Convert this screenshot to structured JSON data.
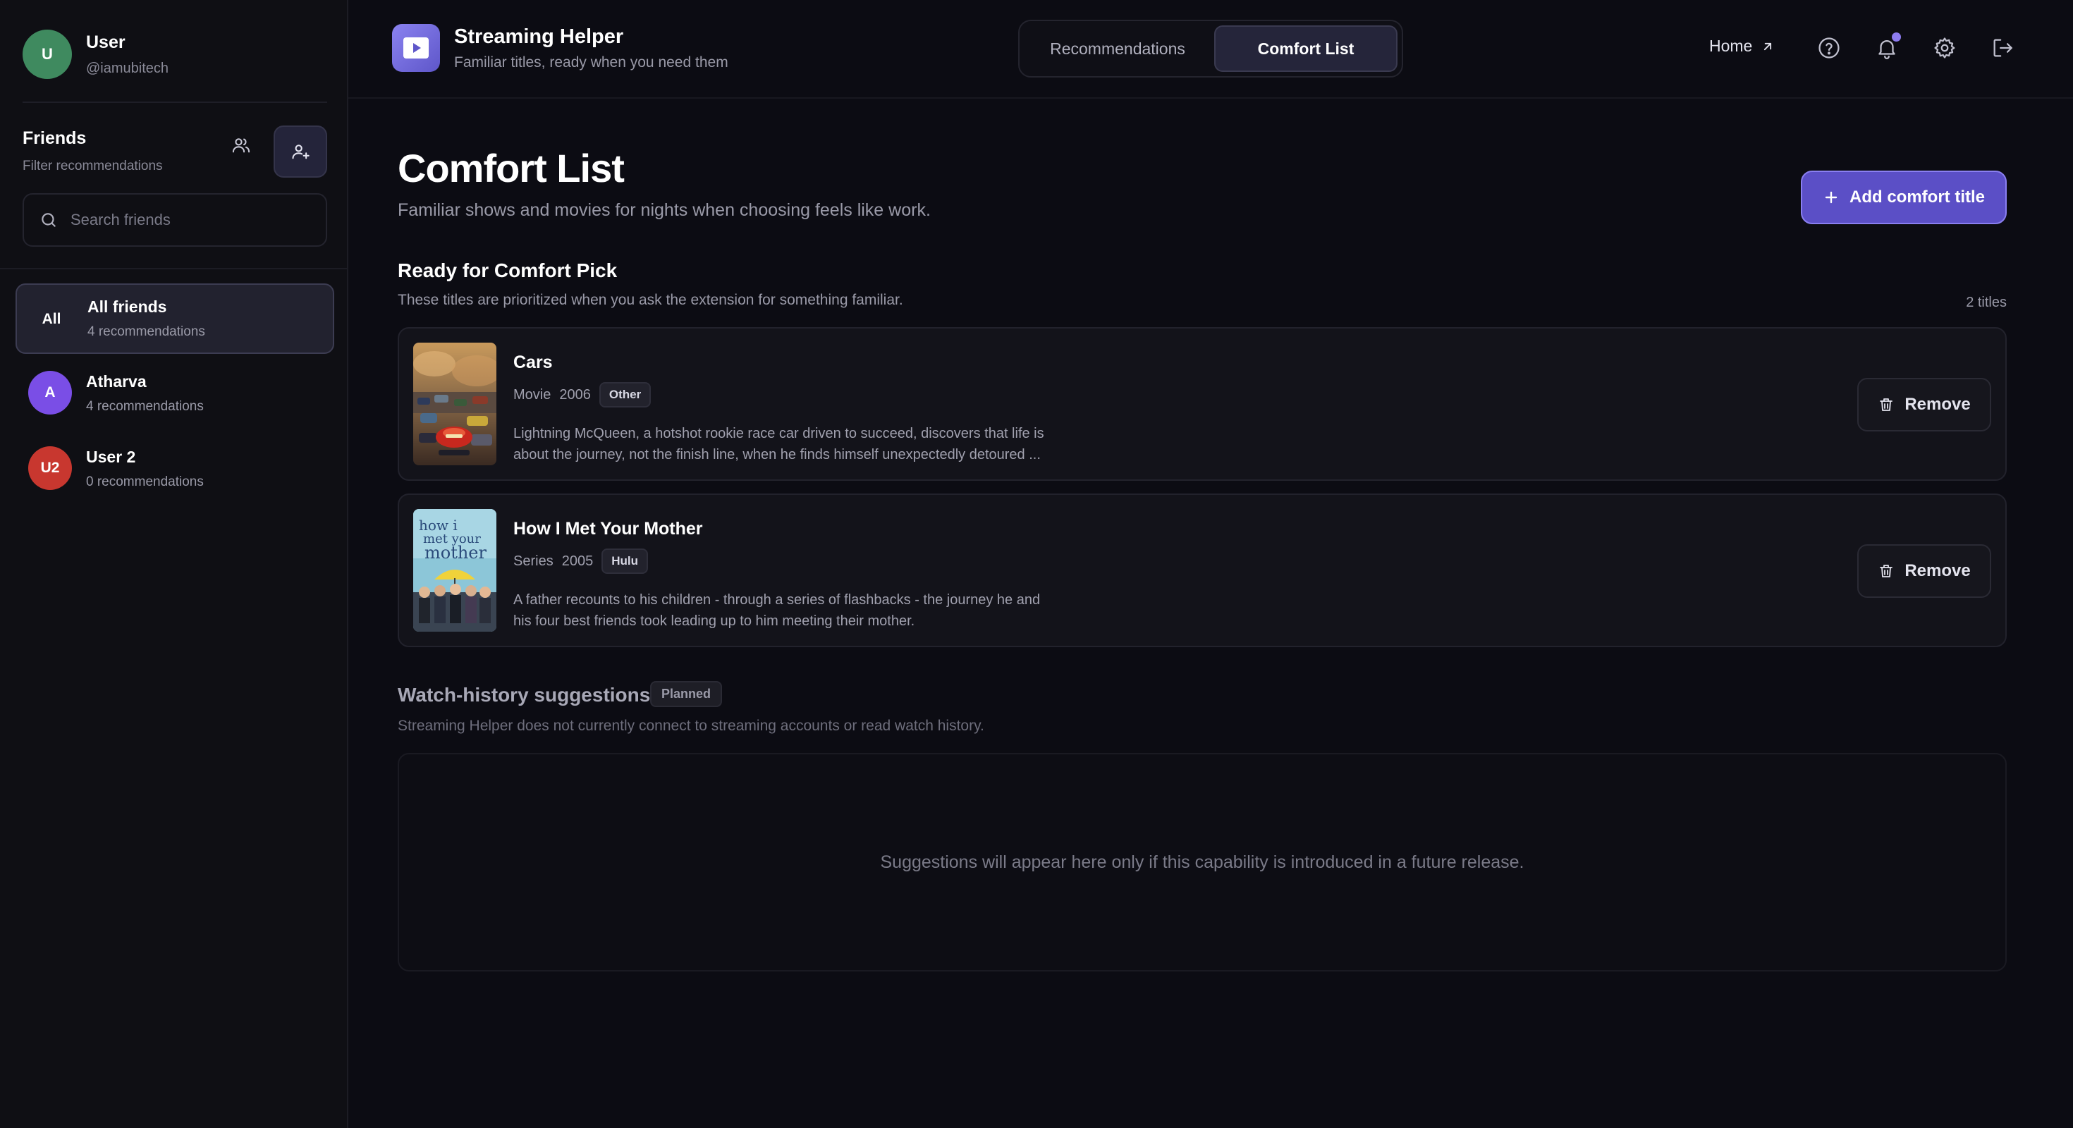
{
  "sidebar": {
    "user": {
      "initial": "U",
      "name": "User",
      "handle": "@iamubitech",
      "avatar_color": "#3f8a5f"
    },
    "friends_title": "Friends",
    "friends_subtitle": "Filter recommendations",
    "search_placeholder": "Search friends",
    "friends": [
      {
        "initial": "All",
        "name": "All friends",
        "count": "4 recommendations",
        "color": "#22222f",
        "active": true
      },
      {
        "initial": "A",
        "name": "Atharva",
        "count": "4 recommendations",
        "color": "#7a4ee6",
        "active": false
      },
      {
        "initial": "U2",
        "name": "User 2",
        "count": "0 recommendations",
        "color": "#c8372f",
        "active": false
      }
    ]
  },
  "header": {
    "app_title": "Streaming Helper",
    "app_subtitle": "Familiar titles, ready when you need them",
    "tabs": [
      {
        "label": "Recommendations",
        "active": false
      },
      {
        "label": "Comfort List",
        "active": true
      }
    ],
    "home_label": "Home",
    "icons": [
      "help-icon",
      "bell-icon",
      "gear-icon",
      "logout-icon"
    ]
  },
  "main": {
    "title": "Comfort List",
    "subtitle": "Familiar shows and movies for nights when choosing feels like work.",
    "add_button": "Add comfort title",
    "ready_section": {
      "title": "Ready for Comfort Pick",
      "subtitle": "These titles are prioritized when you ask the extension for something familiar.",
      "count": "2 titles"
    },
    "items": [
      {
        "title": "Cars",
        "type": "Movie",
        "year": "2006",
        "badge": "Other",
        "description_line1": "Lightning McQueen, a hotshot rookie race car driven to succeed, discovers that life is",
        "description_line2": "about the journey, not the finish line, when he finds himself unexpectedly detoured ...",
        "remove_label": "Remove"
      },
      {
        "title": "How I Met Your Mother",
        "type": "Series",
        "year": "2005",
        "badge": "Hulu",
        "poster_text_1": "how i",
        "poster_text_2": "met your",
        "poster_text_3": "mother",
        "description_line1": "A father recounts to his children - through a series of flashbacks - the journey he and",
        "description_line2": "his four best friends took leading up to him meeting their mother.",
        "remove_label": "Remove"
      }
    ],
    "watch_history": {
      "title": "Watch-history suggestions",
      "badge": "Planned",
      "subtitle": "Streaming Helper does not currently connect to streaming accounts or read watch history.",
      "empty_message": "Suggestions will appear here only if this capability is introduced in a future release."
    }
  },
  "colors": {
    "background": "#0c0c13",
    "accent": "#5b4fc6",
    "accent_border": "#8a7ff0",
    "notification_dot": "#8e7cf0"
  }
}
